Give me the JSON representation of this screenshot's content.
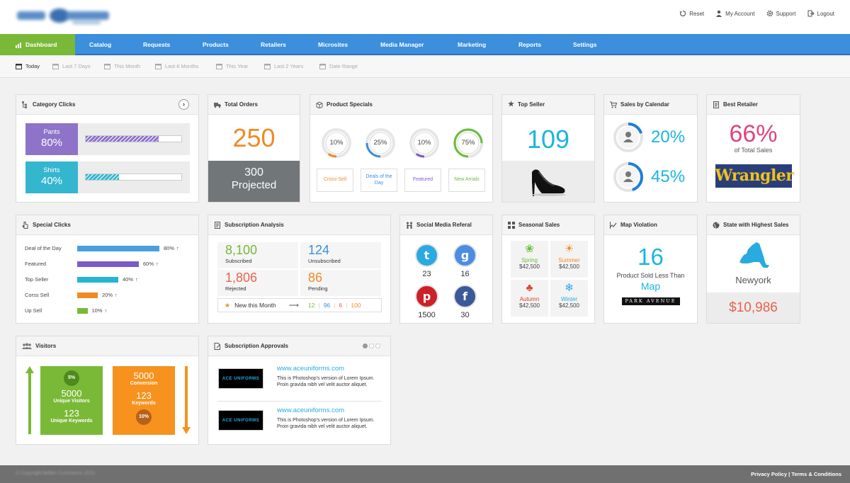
{
  "header": {
    "links": [
      "Reset",
      "My Account",
      "Support",
      "Logout"
    ]
  },
  "nav": {
    "items": [
      "Dashboard",
      "Catalog",
      "Requests",
      "Products",
      "Retailers",
      "Microsites",
      "Media Manager",
      "Marketing",
      "Reports",
      "Settings"
    ]
  },
  "subnav": {
    "items": [
      "Today",
      "Last 7 Days",
      "This Month",
      "Last 6 Months",
      "This Year",
      "Last 2 Years",
      "Date Range"
    ]
  },
  "category_clicks": {
    "title": "Category Clicks",
    "rows": [
      {
        "label": "Pants",
        "value": "80%",
        "fraction": 0.76,
        "color": "#8e73c9"
      },
      {
        "label": "Shirts",
        "value": "40%",
        "fraction": 0.35,
        "color": "#35b6cf"
      }
    ]
  },
  "total_orders": {
    "title": "Total Orders",
    "value": "250",
    "projected_value": "300",
    "projected_label": "Projected"
  },
  "product_specials": {
    "title": "Product Specials",
    "items": [
      {
        "pct": "10%",
        "fraction": 0.1,
        "color": "#f08a24",
        "label": "Cross-Sell"
      },
      {
        "pct": "25%",
        "fraction": 0.25,
        "color": "#3b8fdc",
        "label": "Deals of the Day"
      },
      {
        "pct": "10%",
        "fraction": 0.1,
        "color": "#7b5cc6",
        "label": "Featured"
      },
      {
        "pct": "75%",
        "fraction": 0.75,
        "color": "#6bbf3a",
        "label": "New Arrials"
      }
    ]
  },
  "top_seller": {
    "title": "Top Seller",
    "value": "109"
  },
  "sales_calendar": {
    "title": "Sales by Calendar",
    "items": [
      {
        "pct": "20%",
        "fraction": 0.2
      },
      {
        "pct": "45%",
        "fraction": 0.45
      }
    ]
  },
  "best_retailer": {
    "title": "Best Retailer",
    "pct": "66%",
    "caption": "of Total Sales",
    "brand": "Wrangler"
  },
  "special_clicks": {
    "title": "Special Clicks",
    "rows": [
      {
        "label": "Deal of the Day",
        "value": "80%",
        "fraction": 0.8,
        "color": "#4a9fe0"
      },
      {
        "label": "Featured",
        "value": "60%",
        "fraction": 0.6,
        "color": "#7b5cc6"
      },
      {
        "label": "Top Seller",
        "value": "40%",
        "fraction": 0.4,
        "color": "#23b5d3"
      },
      {
        "label": "Corss Sell",
        "value": "20%",
        "fraction": 0.2,
        "color": "#f08a24"
      },
      {
        "label": "Up Sell",
        "value": "10%",
        "fraction": 0.1,
        "color": "#7ab937"
      }
    ],
    "arrow": "↑"
  },
  "subscription_analysis": {
    "title": "Subscription Analysis",
    "cells": [
      {
        "value": "8,100",
        "label": "Subscribed",
        "color": "#7ab937"
      },
      {
        "value": "124",
        "label": "Unsubscribed",
        "color": "#3b8fdc"
      },
      {
        "value": "1,806",
        "label": "Rejected",
        "color": "#e8624e"
      },
      {
        "value": "86",
        "label": "Pending",
        "color": "#f08a24"
      }
    ],
    "month_label": "New this Month",
    "month_values": [
      "12",
      "96",
      "6",
      "100"
    ],
    "arrow": "⟶"
  },
  "social_media": {
    "title": "Social Media Referal",
    "items": [
      {
        "glyph": "t",
        "count": "23",
        "color": "#29aae1"
      },
      {
        "glyph": "g",
        "count": "16",
        "color": "#4c8de2"
      },
      {
        "glyph": "p",
        "count": "1500",
        "color": "#cc2127"
      },
      {
        "glyph": "f",
        "count": "30",
        "color": "#3b5998"
      }
    ]
  },
  "seasonal_sales": {
    "title": "Seasonal Sales",
    "items": [
      {
        "name": "Spring",
        "amount": "$42,500",
        "color": "#6bbf3a"
      },
      {
        "name": "Summer",
        "amount": "$42,500",
        "color": "#f08a24"
      },
      {
        "name": "Autumn",
        "amount": "$42,500",
        "color": "#d9452f"
      },
      {
        "name": "Winter",
        "amount": "$42,500",
        "color": "#29aae1"
      }
    ]
  },
  "map_violation": {
    "title": "Map Violation",
    "value": "16",
    "line1": "Product Sold Less Than",
    "line2": "Map",
    "brand": "PARK AVENUE"
  },
  "state_sales": {
    "title": "State with Highest Sales",
    "state": "Newyork",
    "amount": "$10,986"
  },
  "visitors": {
    "title": "Visitors",
    "green": {
      "badge": "5%",
      "value1": "5000",
      "label1": "Unique Visitors",
      "value2": "123",
      "label2": "Unique Keywords"
    },
    "orange": {
      "value1": "5000",
      "label1": "Conversion",
      "value2": "123",
      "label2": "Keywords",
      "badge": "10%"
    }
  },
  "subscription_approvals": {
    "title": "Subscription Approvals",
    "items": [
      {
        "url": "www.aceuniforms.com",
        "desc": "This is Photoshop's version  of Lorem Ipsum. Proin gravida nibh vel velit auctor aliquet.",
        "logo": "ACE UNIFORMS"
      },
      {
        "url": "www.aceuniforms.com",
        "desc": "This is Photoshop's version  of Lorem Ipsum. Proin gravida nibh vel velit auctor aliquet.",
        "logo": "ACE UNIFORMS"
      }
    ]
  },
  "footer": {
    "copyright": "© Copyright Belkin Commerce 2015",
    "links": "Privacy Policy | Terms & Conditions"
  }
}
